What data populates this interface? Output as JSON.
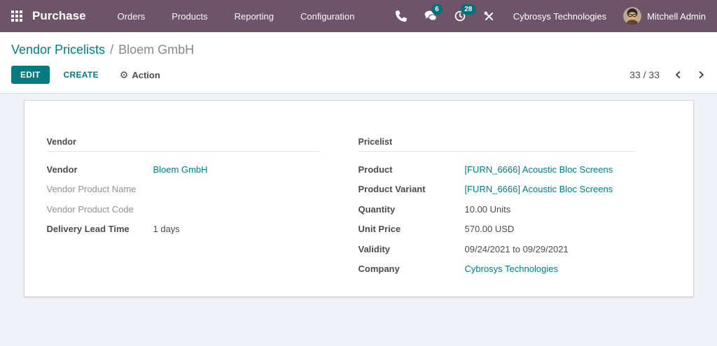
{
  "colors": {
    "navbar_bg": "#6e5468",
    "accent_teal": "#017e84",
    "badge_bg": "#03707a",
    "edit_button_bg": "#077a80",
    "page_bg": "#f1f2f7",
    "text_dark": "#4c4c4c",
    "muted_label": "#919191",
    "pager_arrow": "#374b63"
  },
  "navbar": {
    "apps_icon": "apps-grid-icon",
    "app_name": "Purchase",
    "menu": [
      {
        "label": "Orders"
      },
      {
        "label": "Products"
      },
      {
        "label": "Reporting"
      },
      {
        "label": "Configuration"
      }
    ],
    "icons": [
      "phone-icon",
      "chat-icon",
      "activity-clock-icon",
      "tools-icon"
    ],
    "chat_badge": "6",
    "activity_badge": "28",
    "company": "Cybrosys Technologies",
    "user": "Mitchell Admin"
  },
  "breadcrumb": {
    "parent": "Vendor Pricelists",
    "separator": "/",
    "current": "Bloem GmbH"
  },
  "control_panel": {
    "edit_label": "EDIT",
    "create_label": "CREATE",
    "action_label": "Action",
    "gear_glyph": "⚙",
    "pager_value": "33 / 33"
  },
  "form": {
    "left": {
      "title": "Vendor",
      "rows": [
        {
          "label": "Vendor",
          "value": "Bloem GmbH"
        },
        {
          "label": "Vendor Product Name",
          "value": ""
        },
        {
          "label": "Vendor Product Code",
          "value": ""
        },
        {
          "label": "Delivery Lead Time",
          "value": "1 days"
        }
      ]
    },
    "right": {
      "title": "Pricelist",
      "rows": [
        {
          "label": "Product",
          "value": "[FURN_6666] Acoustic Bloc Screens"
        },
        {
          "label": "Product Variant",
          "value": "[FURN_6666] Acoustic Bloc Screens"
        },
        {
          "label": "Quantity",
          "value": "10.00 Units"
        },
        {
          "label": "Unit Price",
          "value": "570.00 USD"
        },
        {
          "label": "Validity",
          "value": "09/24/2021 to 09/29/2021"
        },
        {
          "label": "Company",
          "value": "Cybrosys Technologies"
        }
      ]
    }
  }
}
